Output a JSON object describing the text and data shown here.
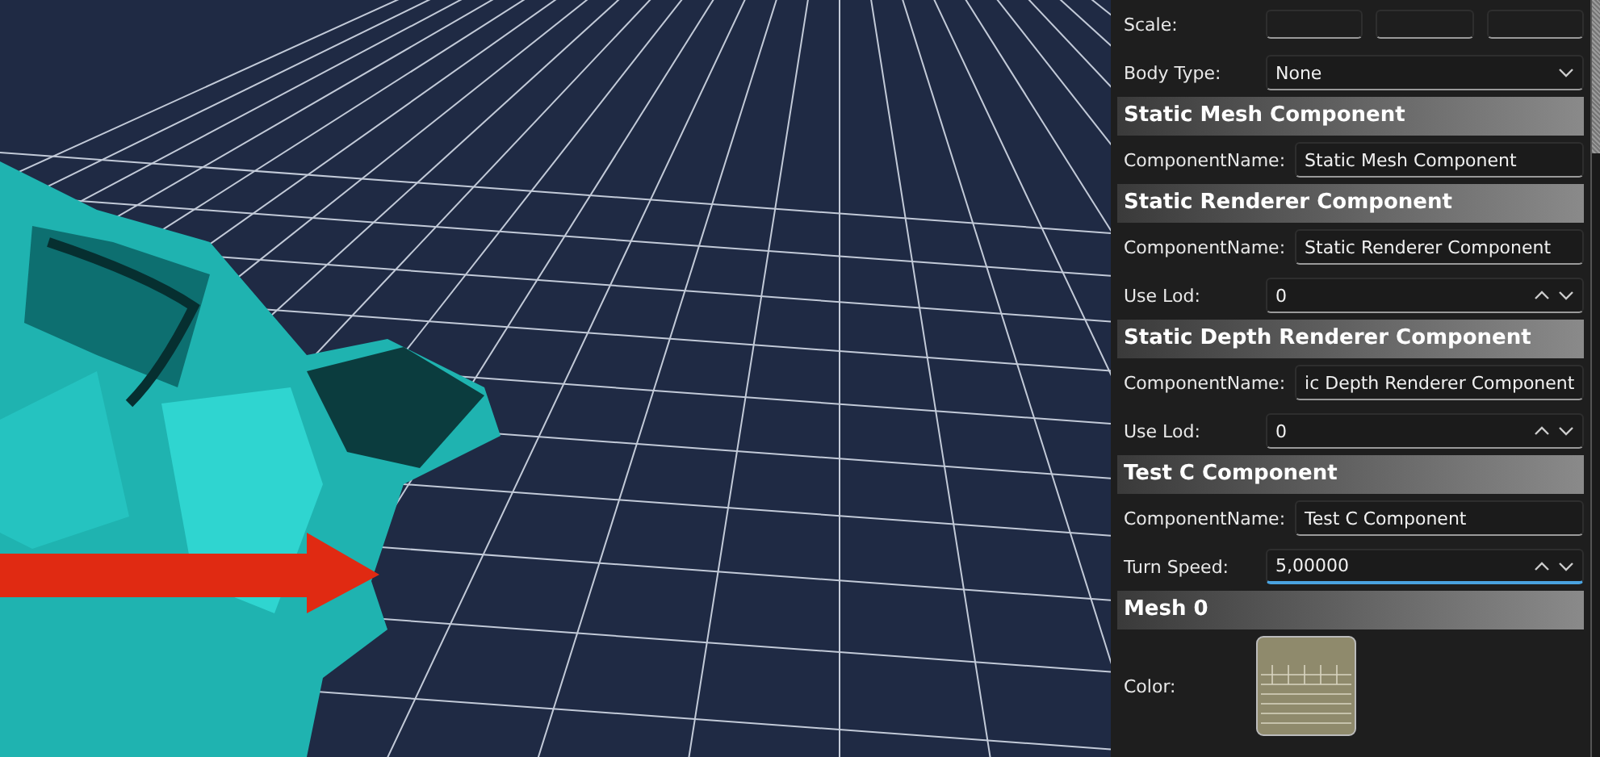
{
  "viewport": {
    "kind": "scene"
  },
  "properties": {
    "top_rows": [
      {
        "kind": "vector",
        "label": "Scale:"
      },
      {
        "kind": "dropdown",
        "label": "Body Type:",
        "value": "None"
      }
    ],
    "sections": [
      {
        "title": "Static Mesh Component",
        "rows": [
          {
            "kind": "text",
            "label": "ComponentName:",
            "value": "Static Mesh Component",
            "focused": false
          }
        ]
      },
      {
        "title": "Static Renderer Component",
        "rows": [
          {
            "kind": "text",
            "label": "ComponentName:",
            "value": "Static Renderer Component",
            "focused": false
          },
          {
            "kind": "spinner",
            "label": "Use Lod:",
            "value": "0",
            "focused": false
          }
        ]
      },
      {
        "title": "Static Depth Renderer Component",
        "rows": [
          {
            "kind": "text",
            "label": "ComponentName:",
            "value": "ic Depth Renderer Component",
            "focused": false
          },
          {
            "kind": "spinner",
            "label": "Use Lod:",
            "value": "0",
            "focused": false
          }
        ]
      },
      {
        "title": "Test C Component",
        "rows": [
          {
            "kind": "text",
            "label": "ComponentName:",
            "value": "Test C Component",
            "focused": false
          },
          {
            "kind": "spinner",
            "label": "Turn Speed:",
            "value": "5,00000",
            "focused": true
          }
        ]
      },
      {
        "title": "Mesh 0",
        "rows": [
          {
            "kind": "color",
            "label": "Color:"
          }
        ]
      }
    ]
  }
}
